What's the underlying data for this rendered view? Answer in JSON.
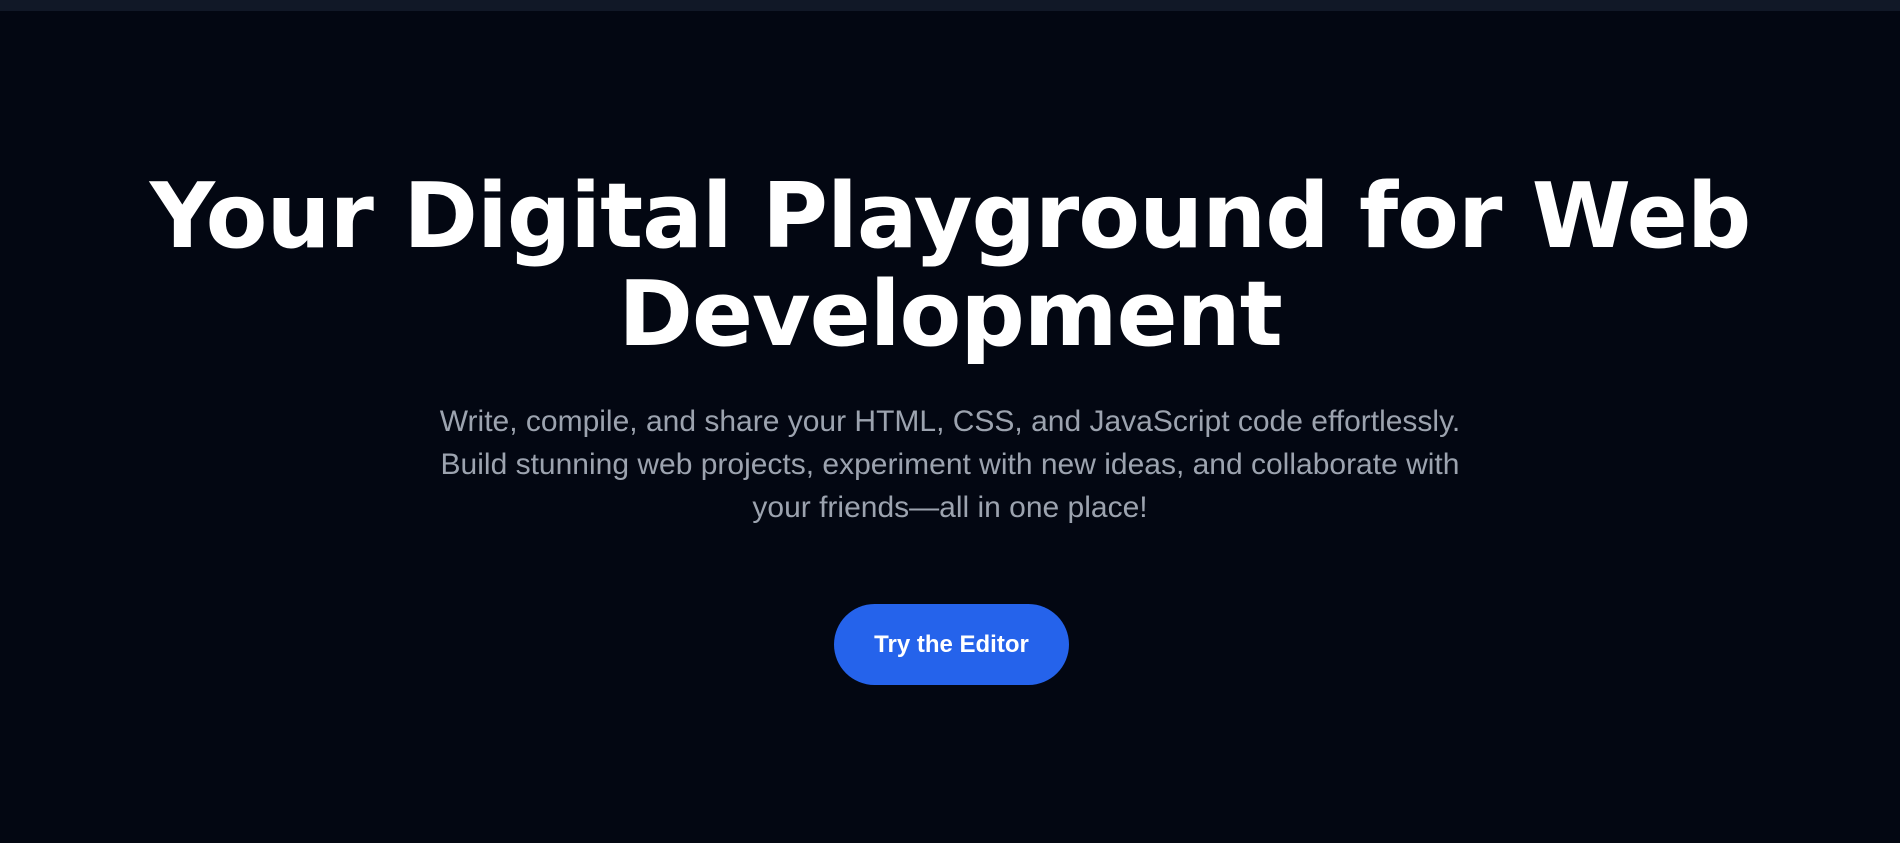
{
  "hero": {
    "title": "Your Digital Playground for Web Development",
    "subtitle": "Write, compile, and share your HTML, CSS, and JavaScript code effortlessly. Build stunning web projects, experiment with new ideas, and collaborate with your friends—all in one place!",
    "cta_label": "Try the Editor"
  },
  "colors": {
    "background": "#030712",
    "top_bar": "#111827",
    "title": "#ffffff",
    "subtitle": "#9ca3af",
    "accent": "#2563eb"
  }
}
